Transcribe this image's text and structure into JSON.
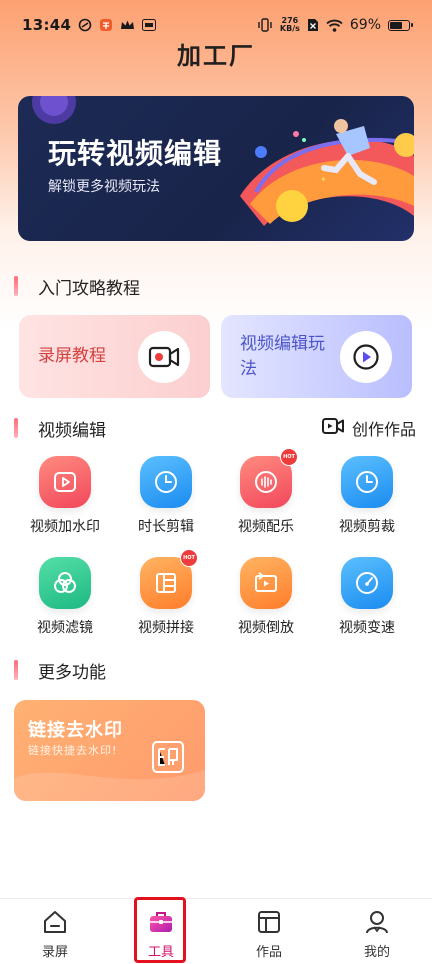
{
  "status_bar": {
    "time": "13:44",
    "net_speed_value": "276",
    "net_speed_unit": "KB/s",
    "battery_percent": "69%",
    "battery_level": 0.69
  },
  "page_title": "加工厂",
  "banner": {
    "title": "玩转视频编辑",
    "subtitle": "解锁更多视频玩法"
  },
  "sections": {
    "tutorials": "入门攻略教程",
    "video_edit": "视频编辑",
    "more": "更多功能"
  },
  "tutorial_cards": [
    {
      "label": "录屏教程",
      "icon": "video-camera-icon"
    },
    {
      "label": "视频编辑玩法",
      "icon": "play-icon"
    }
  ],
  "create_works_label": "创作作品",
  "tools": [
    {
      "label": "视频加水印",
      "icon": "play-square-icon",
      "color": "#f2475b",
      "hot": false
    },
    {
      "label": "时长剪辑",
      "icon": "clock-icon",
      "color": "#1a8bf0",
      "hot": false
    },
    {
      "label": "视频配乐",
      "icon": "audio-wave-icon",
      "color": "#f2475b",
      "hot": true
    },
    {
      "label": "视频剪裁",
      "icon": "clock-icon",
      "color": "#1a8bf0",
      "hot": false
    },
    {
      "label": "视频滤镜",
      "icon": "color-circles-icon",
      "color": "#1db883",
      "hot": false
    },
    {
      "label": "视频拼接",
      "icon": "layout-icon",
      "color": "#ff7d2a",
      "hot": true
    },
    {
      "label": "视频倒放",
      "icon": "rewind-icon",
      "color": "#ff7d2a",
      "hot": false
    },
    {
      "label": "视频变速",
      "icon": "speed-gauge-icon",
      "color": "#1a8bf0",
      "hot": false
    }
  ],
  "hot_badge": "HOT",
  "more_card": {
    "title": "链接去水印",
    "subtitle": "链接快捷去水印!"
  },
  "bottom_nav": [
    {
      "label": "录屏",
      "icon": "home-icon",
      "active": false
    },
    {
      "label": "工具",
      "icon": "toolbox-icon",
      "active": true
    },
    {
      "label": "作品",
      "icon": "works-icon",
      "active": false
    },
    {
      "label": "我的",
      "icon": "profile-icon",
      "active": false
    }
  ],
  "colors": {
    "accent": "#d1106f",
    "highlight": "#e3101f"
  }
}
